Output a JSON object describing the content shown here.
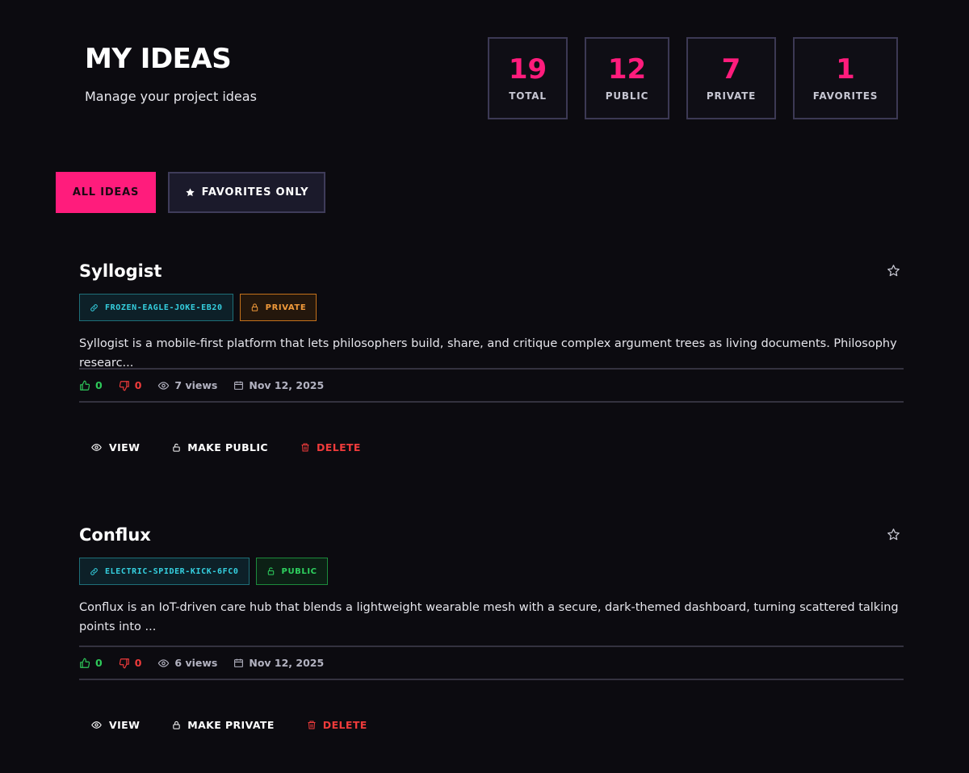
{
  "header": {
    "title": "MY IDEAS",
    "subtitle": "Manage your project ideas"
  },
  "stats": [
    {
      "value": "19",
      "label": "TOTAL"
    },
    {
      "value": "12",
      "label": "PUBLIC"
    },
    {
      "value": "7",
      "label": "PRIVATE"
    },
    {
      "value": "1",
      "label": "FAVORITES"
    }
  ],
  "filters": {
    "all_label": "ALL IDEAS",
    "favorites_label": "FAVORITES ONLY"
  },
  "ideas": [
    {
      "title": "Syllogist",
      "slug": "FROZEN-EAGLE-JOKE-EB20",
      "visibility": "PRIVATE",
      "description": "Syllogist is a mobile-first platform that lets philosophers build, share, and critique complex argument trees as living documents. Philosophy researc...",
      "upvotes": "0",
      "downvotes": "0",
      "views": "7 views",
      "date": "Nov 12, 2025",
      "actions": {
        "view": "VIEW",
        "toggle": "MAKE PUBLIC",
        "delete": "DELETE"
      }
    },
    {
      "title": "Conflux",
      "slug": "ELECTRIC-SPIDER-KICK-6FC0",
      "visibility": "PUBLIC",
      "description": "Conflux is an IoT-driven care hub that blends a lightweight wearable mesh with a secure, dark-themed dashboard, turning scattered talking points into ...",
      "upvotes": "0",
      "downvotes": "0",
      "views": "6 views",
      "date": "Nov 12, 2025",
      "actions": {
        "view": "VIEW",
        "toggle": "MAKE PRIVATE",
        "delete": "DELETE"
      }
    }
  ],
  "colors": {
    "accent": "#ff1c7c",
    "background": "#0c0b10",
    "slug": "#35d0e0",
    "private": "#f19a3a",
    "public": "#2ed15f",
    "danger": "#ef3b3b"
  }
}
